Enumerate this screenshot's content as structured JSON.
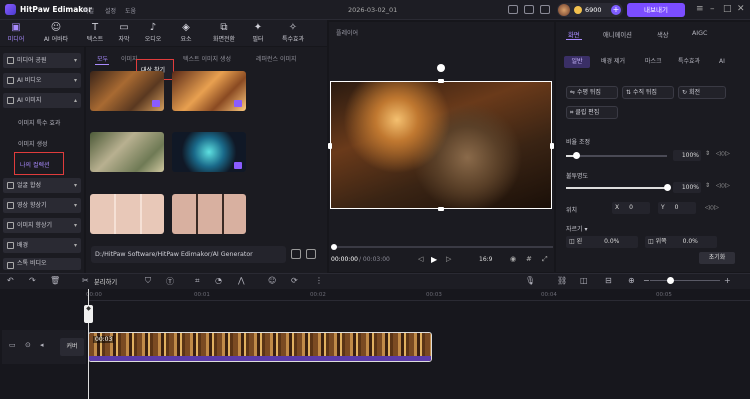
{
  "app": {
    "name": "HitPaw Edimakor",
    "project": "2026-03-02_01"
  },
  "menu": [
    "파일",
    "설정",
    "도움"
  ],
  "credits": {
    "value": "6900"
  },
  "upgrade_label": "내보내기",
  "toolbar": [
    {
      "label": "미디어",
      "icon": "media-icon"
    },
    {
      "label": "AI 어바타",
      "icon": "ai-avatar-icon"
    },
    {
      "label": "텍스트",
      "icon": "text-icon"
    },
    {
      "label": "자막",
      "icon": "subtitle-icon"
    },
    {
      "label": "오디오",
      "icon": "audio-icon"
    },
    {
      "label": "요소",
      "icon": "element-icon"
    },
    {
      "label": "화면전환",
      "icon": "transition-icon"
    },
    {
      "label": "필터",
      "icon": "filter-icon"
    },
    {
      "label": "특수효과",
      "icon": "effect-icon"
    }
  ],
  "sidebar": {
    "items": [
      {
        "label": "미디어 공원"
      },
      {
        "label": "AI 비디오"
      },
      {
        "label": "AI 이미지"
      }
    ],
    "subitems": [
      "이미지 특수 효과",
      "이미지 생성",
      "나의 컬렉션"
    ],
    "lower_items": [
      {
        "label": "얼굴 합성"
      },
      {
        "label": "영상 향상기"
      },
      {
        "label": "이미지 향상기"
      },
      {
        "label": "배경"
      },
      {
        "label": "스톡 비디오"
      }
    ]
  },
  "library": {
    "tabs": [
      "모두",
      "이미지",
      "텍스트 이미지 생성",
      "레퍼런스 이미지"
    ],
    "tooltip": "대상 찾기",
    "path": "D:/HitPaw Software/HitPaw Edimakor/AI Generator"
  },
  "player": {
    "label": "플레이어",
    "time_current": "00:00:00",
    "time_total": "/ 00:03:00",
    "ratio": "16:9"
  },
  "properties": {
    "tabs": [
      "화면",
      "애니메이션",
      "색상",
      "AIGC"
    ],
    "subtabs": [
      "일반",
      "배경 제거",
      "마스크",
      "특수효과",
      "AI"
    ],
    "buttons": [
      "수평 뒤집",
      "수직 뒤집",
      "회전",
      "클립 편집"
    ],
    "scale_label": "비율 조정",
    "scale_value": "100%",
    "scale_level": 0.1,
    "opacity_label": "불투명도",
    "opacity_value": "100%",
    "opacity_level": 1.0,
    "position_label": "위치",
    "x_label": "X",
    "x_value": "0",
    "y_label": "Y",
    "y_value": "0",
    "crop_label": "자르기",
    "crop_left": "0.0%",
    "crop_top": "0.0%",
    "crop_left_label": "왼",
    "crop_top_label": "위쪽",
    "reset_label": "초기화"
  },
  "timeline": {
    "split_label": "분리하기",
    "ticks": [
      "00:00",
      "00:01",
      "00:02",
      "00:03",
      "00:04",
      "00:05"
    ],
    "cover_label": "커버",
    "clip_duration": "00:03"
  }
}
